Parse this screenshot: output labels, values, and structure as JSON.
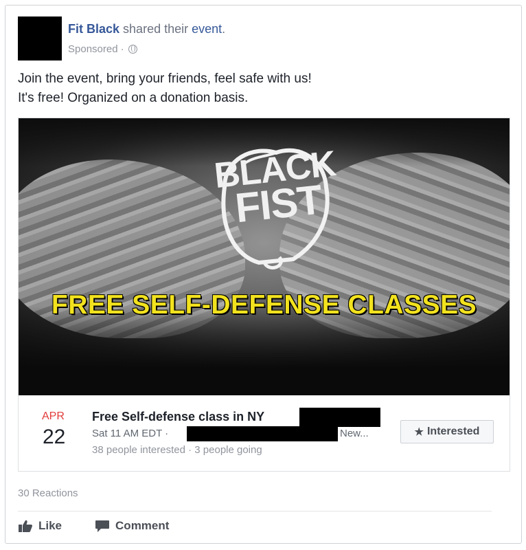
{
  "post": {
    "page_name": "Fit Black",
    "shared_text": "shared their",
    "event_link": "event",
    "period": ".",
    "sponsored": "Sponsored",
    "dot": "·",
    "body_line1": "Join the event, bring your friends, feel safe with us!",
    "body_line2": "It's free! Organized on a donation basis."
  },
  "hero": {
    "logo_line1": "BLACK",
    "logo_line2": "FIST",
    "title": "FREE SELF-DEFENSE CLASSES"
  },
  "event": {
    "month": "APR",
    "day": "22",
    "title": "Free Self-defense class in NY",
    "time": "Sat 11 AM EDT ·",
    "location_end": "New...",
    "interested_count": "38 people interested",
    "dot": "·",
    "going_count": "3 people going",
    "interested_button": "Interested",
    "star_icon": "star-icon",
    "month_color": "#e23b3b"
  },
  "footer": {
    "reactions": "30 Reactions",
    "like_label": "Like",
    "comment_label": "Comment"
  },
  "colors": {
    "link": "#365899",
    "hero_title": "#f2e21e"
  }
}
